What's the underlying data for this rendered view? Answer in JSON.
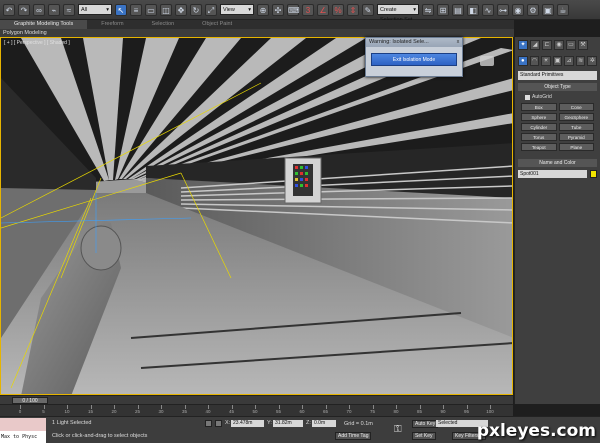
{
  "toolbar": {
    "filter_dropdown": "All",
    "view_dropdown": "View",
    "selection_set_dropdown": "Create Selection Set",
    "icons": [
      "undo-icon",
      "redo-icon",
      "link-icon",
      "unlink-icon",
      "bind-icon",
      "select-icon",
      "select-by-name-icon",
      "rect-region-icon",
      "window-crossing-icon",
      "move-icon",
      "rotate-icon",
      "scale-icon",
      "ref-coord-icon",
      "pivot-icon",
      "select-manipulate-icon",
      "keyboard-shortcut-icon",
      "snap-3-icon",
      "angle-snap-icon",
      "percent-snap-icon",
      "spinner-snap-icon",
      "edit-named-sets-icon",
      "mirror-icon",
      "align-icon",
      "layer-icon",
      "graphite-icon",
      "curve-editor-icon",
      "schematic-icon",
      "material-editor-icon",
      "render-setup-icon",
      "rendered-frame-icon",
      "render-icon"
    ]
  },
  "ribbon": {
    "tabs": [
      "Graphite Modeling Tools",
      "Freeform",
      "Selection",
      "Object Paint"
    ],
    "active_tab": 0,
    "subpanel": "Polygon Modeling"
  },
  "viewport": {
    "label": "[ + ] [ Perspective ] [ Shaded ]"
  },
  "dialog": {
    "title": "Warning: Isolated Sele...",
    "close": "x",
    "button": "Exit Isolation Mode"
  },
  "command_panel": {
    "dropdown": "Standard Primitives",
    "object_type": {
      "title": "Object Type",
      "autogrid": "AutoGrid",
      "primitives": [
        "Box",
        "Cone",
        "Sphere",
        "GeoSphere",
        "Cylinder",
        "Tube",
        "Torus",
        "Pyramid",
        "Teapot",
        "Plane"
      ]
    },
    "name_and_color": {
      "title": "Name and Color",
      "name": "Spot001",
      "color": "#f2e400"
    }
  },
  "time_slider": {
    "position": "0 / 100",
    "current_frame": 0,
    "total_frames": 100,
    "ticks": [
      "0",
      "5",
      "10",
      "15",
      "20",
      "25",
      "30",
      "35",
      "40",
      "45",
      "50",
      "55",
      "60",
      "65",
      "70",
      "75",
      "80",
      "85",
      "90",
      "95",
      "100"
    ]
  },
  "status": {
    "maxscript": "Max to Physc",
    "selection": "1 Light Selected",
    "prompt": "Click or click-and-drag to select objects",
    "x_label": "X:",
    "x": "23.478m",
    "y_label": "Y:",
    "y": "31.82m",
    "z_label": "Z:",
    "z": "0.0m",
    "grid": "Grid = 0.1m",
    "add_time_tag": "Add Time Tag",
    "auto_key": "Auto Key",
    "set_key": "Set Key",
    "selected": "Selected",
    "key_filters": "Key Filters..."
  },
  "watermark": "pxleyes.com"
}
